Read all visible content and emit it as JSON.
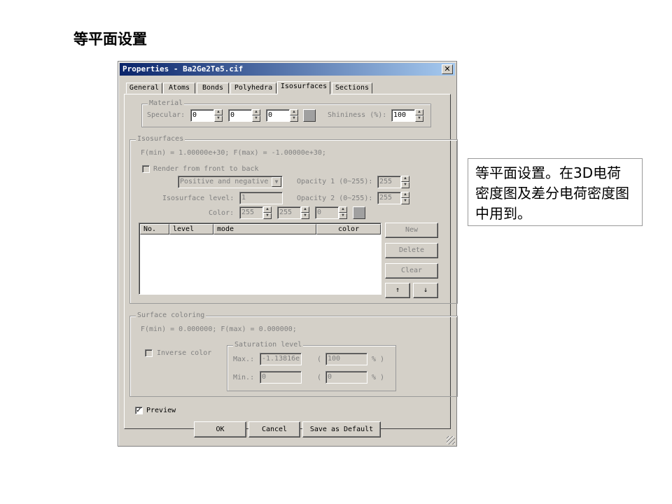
{
  "slide": {
    "title": "等平面设置",
    "note": "等平面设置。在3D电荷密度图及差分电荷密度图中用到。"
  },
  "window": {
    "title": "Properties - Ba2Ge2Te5.cif",
    "close_glyph": "✕"
  },
  "tabs": [
    "General",
    "Atoms",
    "Bonds",
    "Polyhedra",
    "Isosurfaces",
    "Sections"
  ],
  "material": {
    "label": "Material",
    "specular_label": "Specular:",
    "specular": [
      "0",
      "0",
      "0"
    ],
    "shininess_label": "Shininess (%):",
    "shininess": "100"
  },
  "isosurfaces": {
    "label": "Isosurfaces",
    "range_text": "F(min) = 1.00000e+30;   F(max) = -1.00000e+30;",
    "render_label": "Render from front to back",
    "mode_value": "Positive and negative",
    "opacity1_label": "Opacity 1 (0~255):",
    "opacity1": "255",
    "opacity2_label": "Opacity 2 (0~255):",
    "opacity2": "255",
    "level_label": "Isosurface level:",
    "level_value": "1",
    "color_label": "Color:",
    "color": [
      "255",
      "255",
      "0"
    ],
    "columns": [
      "No.",
      "level",
      "mode",
      "color"
    ],
    "buttons": {
      "new": "New",
      "delete": "Delete",
      "clear": "Clear",
      "up": "↑",
      "down": "↓"
    }
  },
  "surface_coloring": {
    "label": "Surface coloring",
    "range_text": "F(min) = 0.000000;   F(max) = 0.000000;",
    "inverse_label": "Inverse color",
    "saturation_label": "Saturation level",
    "max_label": "Max.:",
    "max_value": "-1.13816e",
    "max_pct": "100",
    "min_label": "Min.:",
    "min_value": "0",
    "min_pct": "0",
    "paren": "(",
    "pct_suffix": "% )"
  },
  "preview": {
    "label": "Preview",
    "checked": "✓"
  },
  "footer": {
    "ok": "OK",
    "cancel": "Cancel",
    "save_default": "Save as Default"
  }
}
